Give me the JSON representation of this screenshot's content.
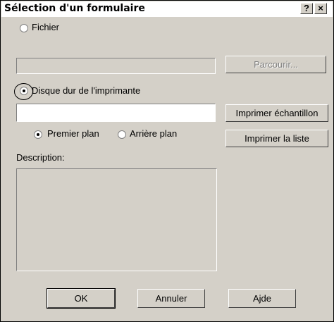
{
  "window": {
    "title": "Sélection d'un formulaire"
  },
  "titlebar_buttons": {
    "help": "?",
    "close": "×"
  },
  "file_option": {
    "label": "Fichier",
    "selected": false
  },
  "file_path": {
    "value": ""
  },
  "browse_button": {
    "label": "Parcourir...",
    "enabled": false
  },
  "disk_option": {
    "label": "Disque dur de l'imprimante",
    "selected": true
  },
  "disk_input": {
    "value": ""
  },
  "print_sample_button": {
    "label": "Imprimer échantillon"
  },
  "print_list_button": {
    "label": "Imprimer la liste"
  },
  "plane_options": {
    "foreground": "Premier plan",
    "background": "Arrière plan",
    "selected": "foreground"
  },
  "description": {
    "label": "Description:",
    "value": ""
  },
  "footer": {
    "ok": "OK",
    "cancel": "Annuler",
    "help": "Ajde"
  }
}
